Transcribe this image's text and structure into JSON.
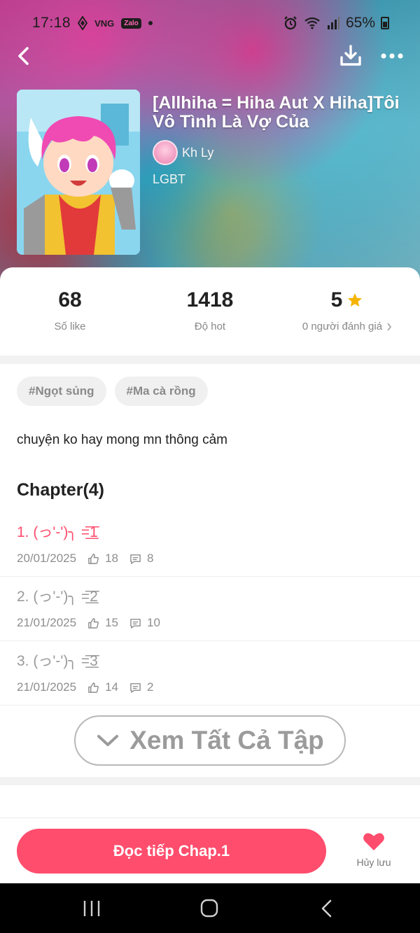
{
  "status_bar": {
    "time": "17:18",
    "carrier_label": "VNG",
    "app_badge": "Zalo",
    "battery": "65%"
  },
  "nav": {
    "back_icon": "chevron-left-icon",
    "download_icon": "download-icon",
    "more_icon": "more-dots-icon"
  },
  "book": {
    "title": "[Allhiha = Hiha Aut X Hiha]Tôi Vô Tình Là Vợ Của",
    "author": "Kh Ly",
    "genre": "LGBT"
  },
  "stats": {
    "likes_value": "68",
    "likes_label": "Số like",
    "hot_value": "1418",
    "hot_label": "Độ hot",
    "rating_value": "5",
    "rating_label": "0 người đánh giá"
  },
  "tags": [
    "#Ngọt sủng",
    "#Ma cà rồng"
  ],
  "description": "chuyện ko hay mong mn thông cảm",
  "chapters": {
    "heading": "Chapter(4)",
    "items": [
      {
        "title": "1. (っ'-')╮ =͟͟͞͞1",
        "date": "20/01/2025",
        "likes": "18",
        "comments": "8"
      },
      {
        "title": "2. (っ'-')╮ =͟͟͞͞2",
        "date": "21/01/2025",
        "likes": "15",
        "comments": "10"
      },
      {
        "title": "3. (っ'-')╮ =͟͟͞͞3",
        "date": "21/01/2025",
        "likes": "14",
        "comments": "2"
      }
    ],
    "view_all_label": "Xem Tất Cả Tập"
  },
  "actions": {
    "read_label": "Đọc tiếp Chap.1",
    "unsave_label": "Hủy lưu"
  },
  "colors": {
    "accent": "#ff4d6d",
    "star": "#f5b400",
    "muted_text": "#8e8e8e"
  }
}
